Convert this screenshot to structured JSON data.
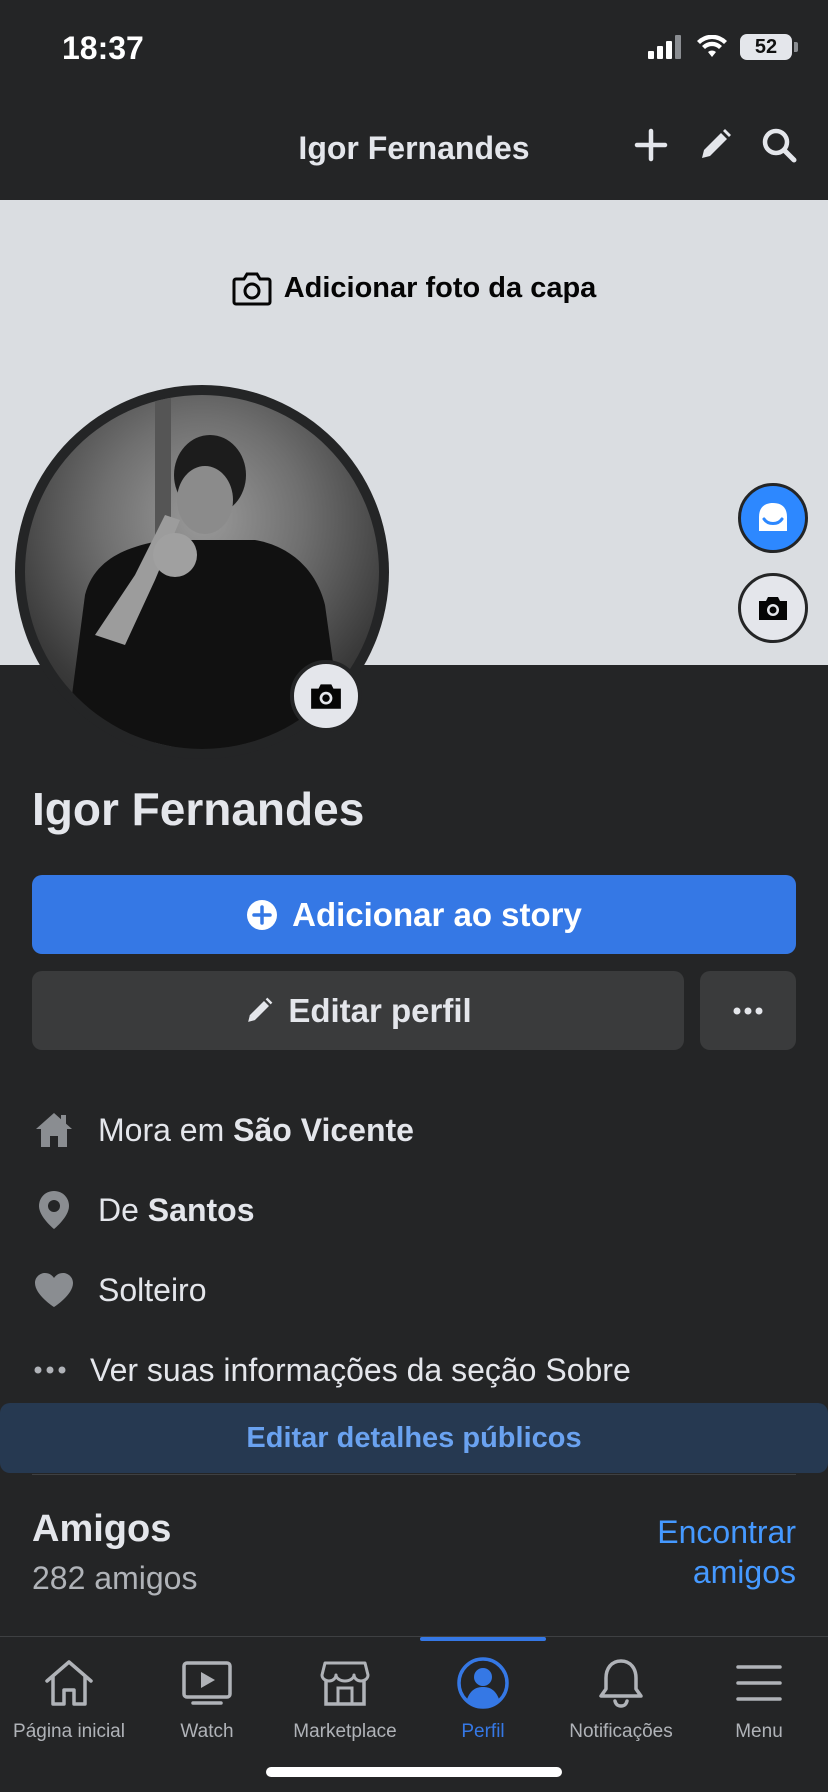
{
  "status_bar": {
    "time": "18:37",
    "battery": "52"
  },
  "header": {
    "title": "Igor Fernandes"
  },
  "cover": {
    "add_cover_label": "Adicionar foto da capa"
  },
  "profile": {
    "name": "Igor Fernandes"
  },
  "actions": {
    "add_story_label": "Adicionar ao story",
    "edit_profile_label": "Editar perfil"
  },
  "details": {
    "lives_prefix": "Mora em ",
    "lives_city": "São Vicente",
    "from_prefix": "De ",
    "from_city": "Santos",
    "relationship": "Solteiro",
    "see_about": "Ver suas informações da seção Sobre",
    "edit_public_label": "Editar detalhes públicos"
  },
  "friends": {
    "title": "Amigos",
    "count": "282 amigos",
    "find_line1": "Encontrar",
    "find_line2": "amigos"
  },
  "tabs": [
    {
      "label": "Página inicial",
      "icon": "home-icon"
    },
    {
      "label": "Watch",
      "icon": "watch-icon"
    },
    {
      "label": "Marketplace",
      "icon": "marketplace-icon"
    },
    {
      "label": "Perfil",
      "icon": "profile-icon"
    },
    {
      "label": "Notificações",
      "icon": "bell-icon"
    },
    {
      "label": "Menu",
      "icon": "menu-icon"
    }
  ],
  "colors": {
    "accent": "#3578e5",
    "background": "#242526",
    "cover": "#dadde1"
  }
}
